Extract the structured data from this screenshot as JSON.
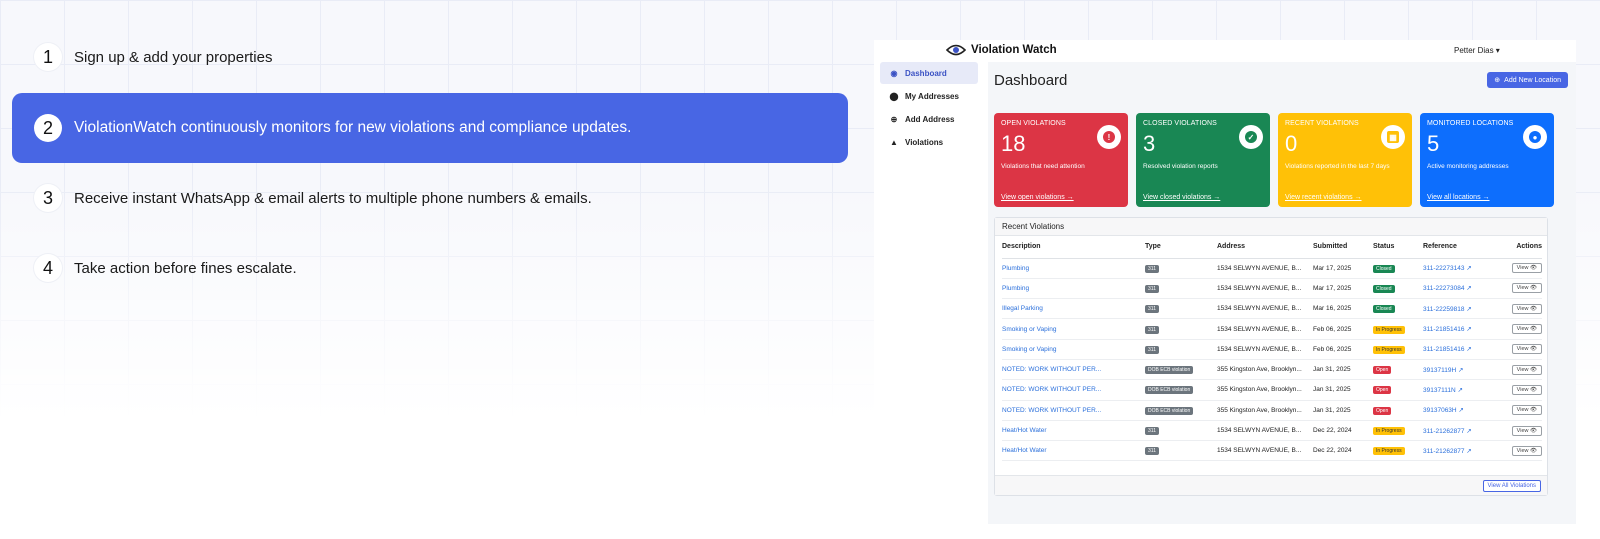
{
  "steps": [
    {
      "num": "1",
      "text": "Sign up & add your properties"
    },
    {
      "num": "2",
      "text": "ViolationWatch continuously monitors for new violations and compliance updates."
    },
    {
      "num": "3",
      "text": "Receive instant WhatsApp & email alerts to multiple phone numbers & emails."
    },
    {
      "num": "4",
      "text": "Take action before fines escalate."
    }
  ],
  "dashboard": {
    "brand": "Violation Watch",
    "user": "Petter Dias ▾",
    "sidebar": [
      {
        "label": "Dashboard",
        "icon": "dashboard-icon"
      },
      {
        "label": "My Addresses",
        "icon": "location-pin-icon"
      },
      {
        "label": "Add Address",
        "icon": "plus-circle-icon"
      },
      {
        "label": "Violations",
        "icon": "warning-icon"
      }
    ],
    "title": "Dashboard",
    "add_button": "Add New Location",
    "cards": [
      {
        "title": "OPEN VIOLATIONS",
        "value": "18",
        "sub": "Violations that need attention",
        "link": "View open violations →",
        "color": "#dc3545",
        "icon": "alert-icon"
      },
      {
        "title": "CLOSED VIOLATIONS",
        "value": "3",
        "sub": "Resolved violation reports",
        "link": "View closed violations →",
        "color": "#198754",
        "icon": "check-icon"
      },
      {
        "title": "RECENT VIOLATIONS",
        "value": "0",
        "sub": "Violations reported in the last 7 days",
        "link": "View recent violations →",
        "color": "#ffc107",
        "icon": "calendar-icon"
      },
      {
        "title": "MONITORED LOCATIONS",
        "value": "5",
        "sub": "Active monitoring addresses",
        "link": "View all locations →",
        "color": "#0d6efd",
        "icon": "location-pin-icon"
      }
    ],
    "recent": {
      "title": "Recent Violations",
      "columns": [
        "Description",
        "Type",
        "Address",
        "Submitted",
        "Status",
        "Reference",
        "Actions"
      ],
      "rows": [
        {
          "desc": "Plumbing",
          "type": "311",
          "address": "1534 SELWYN AVENUE, B...",
          "submitted": "Mar 17, 2025",
          "status": "Closed",
          "ref": "311-22273143 ↗"
        },
        {
          "desc": "Plumbing",
          "type": "311",
          "address": "1534 SELWYN AVENUE, B...",
          "submitted": "Mar 17, 2025",
          "status": "Closed",
          "ref": "311-22273084 ↗"
        },
        {
          "desc": "Illegal Parking",
          "type": "311",
          "address": "1534 SELWYN AVENUE, B...",
          "submitted": "Mar 16, 2025",
          "status": "Closed",
          "ref": "311-22259818 ↗"
        },
        {
          "desc": "Smoking or Vaping",
          "type": "311",
          "address": "1534 SELWYN AVENUE, B...",
          "submitted": "Feb 06, 2025",
          "status": "In Progress",
          "ref": "311-21851416 ↗"
        },
        {
          "desc": "Smoking or Vaping",
          "type": "311",
          "address": "1534 SELWYN AVENUE, B...",
          "submitted": "Feb 06, 2025",
          "status": "In Progress",
          "ref": "311-21851416 ↗"
        },
        {
          "desc": "NOTED: WORK WITHOUT PER...",
          "type": "DOB ECB violation",
          "address": "355 Kingston Ave, Brooklyn...",
          "submitted": "Jan 31, 2025",
          "status": "Open",
          "ref": "39137119H ↗"
        },
        {
          "desc": "NOTED: WORK WITHOUT PER...",
          "type": "DOB ECB violation",
          "address": "355 Kingston Ave, Brooklyn...",
          "submitted": "Jan 31, 2025",
          "status": "Open",
          "ref": "39137111N ↗"
        },
        {
          "desc": "NOTED: WORK WITHOUT PER...",
          "type": "DOB ECB violation",
          "address": "355 Kingston Ave, Brooklyn...",
          "submitted": "Jan 31, 2025",
          "status": "Open",
          "ref": "39137063H ↗"
        },
        {
          "desc": "Heat/Hot Water",
          "type": "311",
          "address": "1534 SELWYN AVENUE, B...",
          "submitted": "Dec 22, 2024",
          "status": "In Progress",
          "ref": "311-21262877 ↗"
        },
        {
          "desc": "Heat/Hot Water",
          "type": "311",
          "address": "1534 SELWYN AVENUE, B...",
          "submitted": "Dec 22, 2024",
          "status": "In Progress",
          "ref": "311-21262877 ↗"
        }
      ],
      "view_label": "View 👁",
      "view_all": "View All Violations"
    }
  }
}
